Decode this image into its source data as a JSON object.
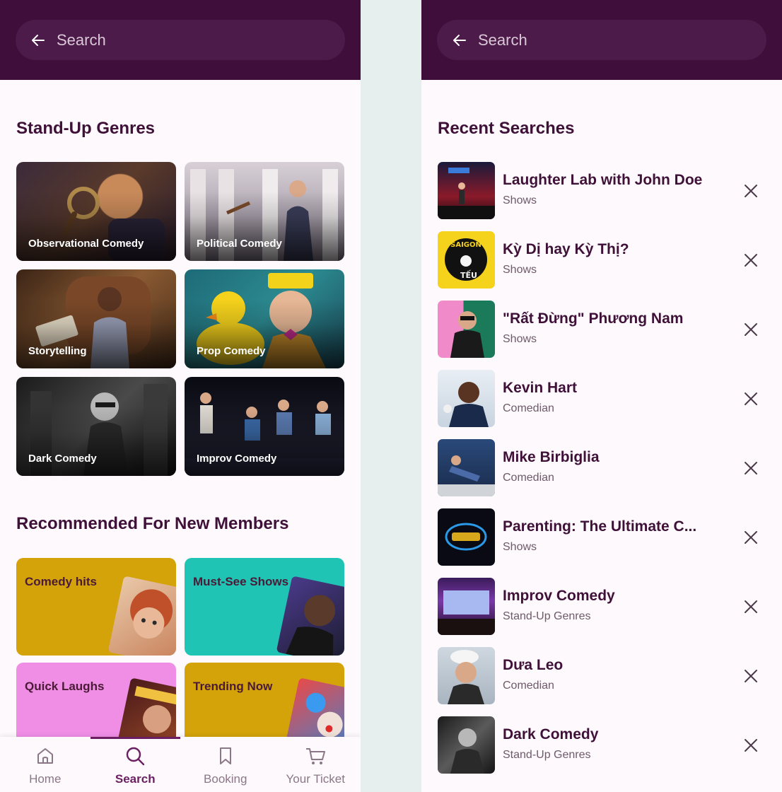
{
  "search": {
    "placeholder": "Search"
  },
  "left": {
    "genres_title": "Stand-Up Genres",
    "genres": [
      {
        "label": "Observational Comedy"
      },
      {
        "label": "Political Comedy"
      },
      {
        "label": "Storytelling"
      },
      {
        "label": "Prop Comedy"
      },
      {
        "label": "Dark Comedy"
      },
      {
        "label": "Improv Comedy"
      }
    ],
    "recommended_title": "Recommended For New Members",
    "recommended": [
      {
        "label": "Comedy hits",
        "color": "#d4a309"
      },
      {
        "label": "Must-See Shows",
        "color": "#1fc4b4"
      },
      {
        "label": "Quick Laughs",
        "color": "#f08ee6"
      },
      {
        "label": "Trending Now",
        "color": "#d4a309"
      }
    ],
    "nav": [
      {
        "label": "Home",
        "icon": "home-icon"
      },
      {
        "label": "Search",
        "icon": "search-icon"
      },
      {
        "label": "Booking",
        "icon": "bookmark-icon"
      },
      {
        "label": "Your Ticket",
        "icon": "cart-icon"
      }
    ],
    "active_nav": "Search"
  },
  "right": {
    "recent_title": "Recent Searches",
    "recent": [
      {
        "title": "Laughter Lab with John Doe",
        "subtitle": "Shows"
      },
      {
        "title": "Kỳ Dị hay Kỳ Thị?",
        "subtitle": "Shows"
      },
      {
        "title": "\"Rất Đừng\" Phương Nam",
        "subtitle": "Shows"
      },
      {
        "title": "Kevin Hart",
        "subtitle": "Comedian"
      },
      {
        "title": "Mike Birbiglia",
        "subtitle": "Comedian"
      },
      {
        "title": "Parenting: The Ultimate C...",
        "subtitle": "Shows"
      },
      {
        "title": "Improv Comedy",
        "subtitle": "Stand-Up Genres"
      },
      {
        "title": "Dưa Leo",
        "subtitle": "Comedian"
      },
      {
        "title": "Dark Comedy",
        "subtitle": "Stand-Up Genres"
      }
    ],
    "thumb_text": {
      "saigon": "SAIGON",
      "teu": "TẾU"
    }
  },
  "colors": {
    "header": "#3f0e3b",
    "accent": "#6b1f62",
    "background": "#fdf9fc"
  }
}
